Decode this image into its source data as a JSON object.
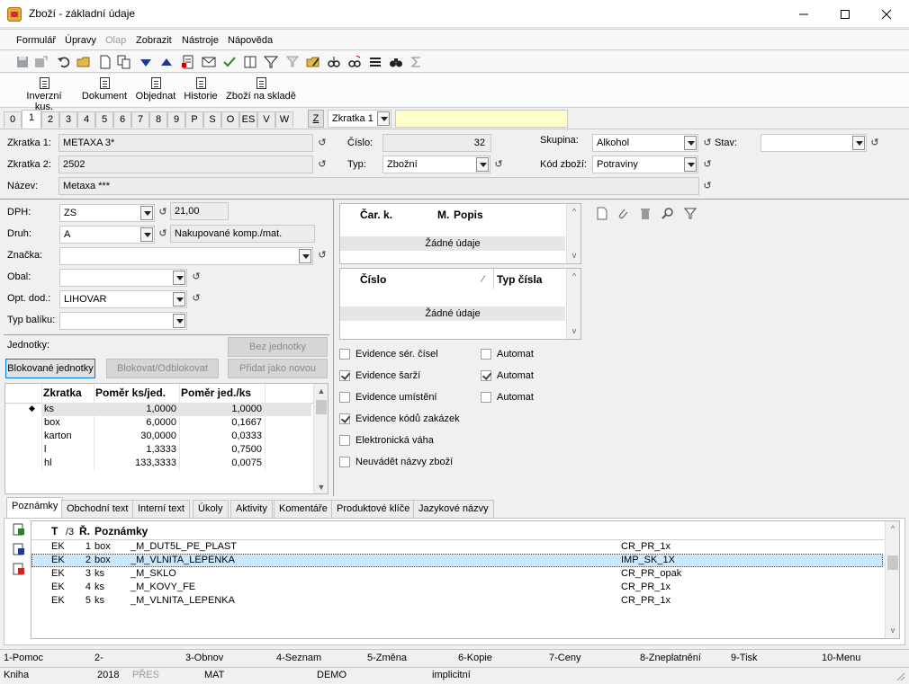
{
  "window": {
    "title": "Zboží - základní údaje"
  },
  "menu": [
    "Formulář",
    "Úpravy",
    "Olap",
    "Zobrazit",
    "Nástroje",
    "Nápověda"
  ],
  "actions": [
    "Inverzní kus.",
    "Dokument",
    "Objednat",
    "Historie",
    "Zboží na skladě"
  ],
  "page_tabs": [
    "0",
    "1",
    "2",
    "3",
    "4",
    "5",
    "6",
    "7",
    "8",
    "9",
    "P",
    "S",
    "O",
    "ES",
    "V",
    "W"
  ],
  "zkratka_search": {
    "z_label": "Z",
    "combo": "Zkratka 1",
    "value": ""
  },
  "header": {
    "zkratka1_label": "Zkratka 1:",
    "zkratka1": "METAXA 3*",
    "zkratka2_label": "Zkratka 2:",
    "zkratka2": "2502",
    "nazev_label": "Název:",
    "nazev": "Metaxa ***",
    "cislo_label": "Číslo:",
    "cislo": "32",
    "typ_label": "Typ:",
    "typ": "Zbožní",
    "skupina_label": "Skupina:",
    "skupina": "Alkohol",
    "kod_label": "Kód zboží:",
    "kod": "Potraviny",
    "stav_label": "Stav:",
    "stav": ""
  },
  "left": {
    "dph_label": "DPH:",
    "dph": "ZS",
    "dph_rate": "21,00",
    "druh_label": "Druh:",
    "druh": "A",
    "druh_desc": "Nakupované komp./mat.",
    "znacka_label": "Značka:",
    "znacka": "",
    "obal_label": "Obal:",
    "obal": "",
    "opt_label": "Opt. dod.:",
    "opt": "LIHOVAR",
    "typbal_label": "Typ balíku:",
    "typbal": ""
  },
  "units": {
    "label": "Jednotky:",
    "btn_none": "Bez jednotky",
    "btn_blocked": "Blokované jednotky",
    "btn_block": "Blokovat/Odblokovat",
    "btn_add": "Přidat jako novou",
    "columns": [
      "Zkratka",
      "Poměr ks/jed.",
      "Poměr jed./ks"
    ],
    "rows": [
      {
        "z": "ks",
        "a": "1,0000",
        "b": "1,0000"
      },
      {
        "z": "box",
        "a": "6,0000",
        "b": "0,1667"
      },
      {
        "z": "karton",
        "a": "30,0000",
        "b": "0,0333"
      },
      {
        "z": "l",
        "a": "1,3333",
        "b": "0,7500"
      },
      {
        "z": "hl",
        "a": "133,3333",
        "b": "0,0075"
      }
    ]
  },
  "barcodes": {
    "col1": "Čar. k.",
    "col2": "M.",
    "col3": "Popis",
    "empty": "Žádné údaje"
  },
  "numbers": {
    "col1": "Číslo",
    "col2": "Typ čísla",
    "empty": "Žádné údaje"
  },
  "checks": [
    {
      "label": "Evidence sér. čísel",
      "on": false,
      "auto": "Automat",
      "auto_on": false
    },
    {
      "label": "Evidence šarží",
      "on": true,
      "auto": "Automat",
      "auto_on": true
    },
    {
      "label": "Evidence umístění",
      "on": false,
      "auto": "Automat",
      "auto_on": false
    },
    {
      "label": "Evidence kódů zakázek",
      "on": true
    },
    {
      "label": "Elektronická váha",
      "on": false
    },
    {
      "label": "Neuvádět názvy zboží",
      "on": false
    }
  ],
  "bottom_tabs": [
    "Poznámky",
    "Obchodní text",
    "Interní text",
    "Úkoly",
    "Aktivity",
    "Komentáře",
    "Produktové klíče",
    "Jazykové názvy"
  ],
  "notes": {
    "columns": [
      "T",
      "/3",
      "Ř.",
      "Poznámky"
    ],
    "rows": [
      {
        "t": "EK",
        "n": "1",
        "u": "box",
        "text": "_M_DUT5L_PE_PLAST",
        "code": "CR_PR_1x"
      },
      {
        "t": "EK",
        "n": "2",
        "u": "box",
        "text": "_M_VLNITA_LEPENKA",
        "code": "IMP_SK_1X"
      },
      {
        "t": "EK",
        "n": "3",
        "u": "ks",
        "text": "_M_SKLO",
        "code": "CR_PR_opak"
      },
      {
        "t": "EK",
        "n": "4",
        "u": "ks",
        "text": "_M_KOVY_FE",
        "code": "CR_PR_1x"
      },
      {
        "t": "EK",
        "n": "5",
        "u": "ks",
        "text": "_M_VLNITA_LEPENKA",
        "code": "CR_PR_1x"
      }
    ]
  },
  "fkeys": [
    "1-Pomoc",
    "2-",
    "3-Obnov",
    "4-Seznam",
    "5-Změna",
    "6-Kopie",
    "7-Ceny",
    "8-Zneplatnění",
    "9-Tisk",
    "10-Menu"
  ],
  "statusbar": [
    "Kniha",
    "2018",
    "PŘES",
    "MAT",
    "DEMO",
    "implicitní"
  ]
}
